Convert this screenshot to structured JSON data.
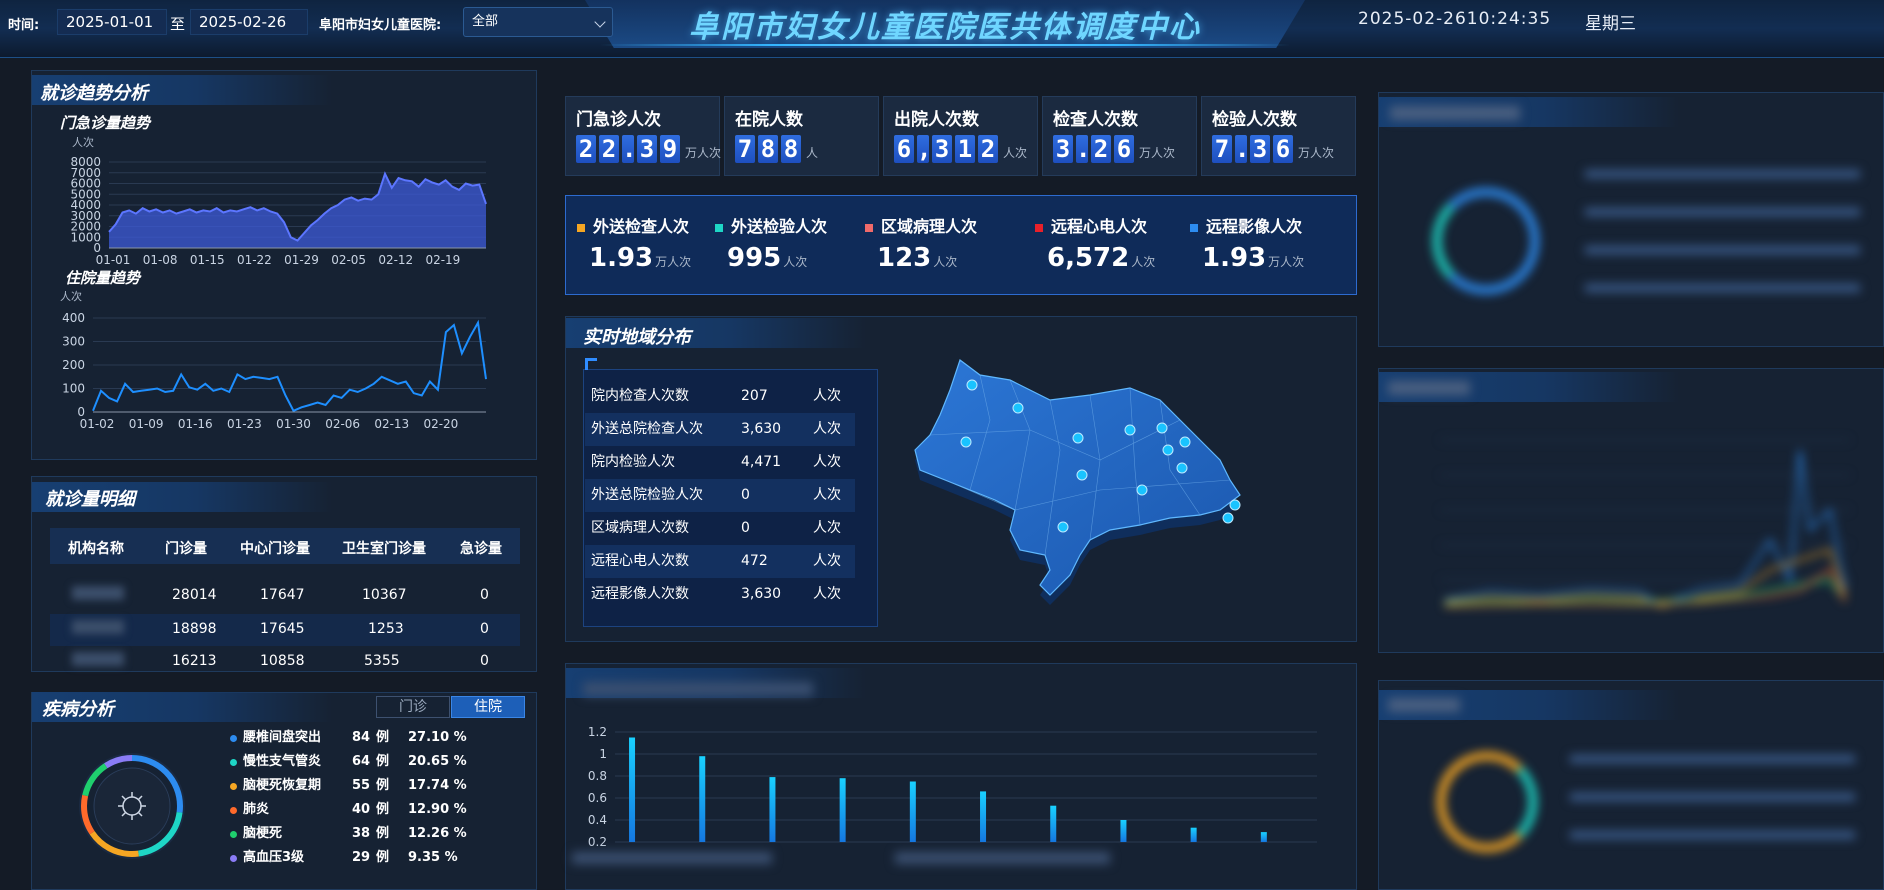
{
  "header": {
    "time_label": "时间:",
    "start_date": "2025-01-01",
    "to_label": "至",
    "end_date": "2025-02-26",
    "hospital_label": "阜阳市妇女儿童医院:",
    "hospital_select": "全部",
    "title": "阜阳市妇女儿童医院医共体调度中心",
    "datetime": "2025-02-2610:24:35",
    "weekday": "星期三",
    "accent": "#6fd6ff"
  },
  "trend_panel": {
    "title": "就诊趋势分析",
    "outpatient_title": "门急诊量趋势",
    "outpatient_unit": "人次",
    "inpatient_title": "住院量趋势",
    "inpatient_unit": "人次"
  },
  "stats": [
    {
      "label": "门急诊人次",
      "value": "22.39",
      "unit": "万人次"
    },
    {
      "label": "在院人数",
      "value": "788",
      "unit": "人"
    },
    {
      "label": "出院人次数",
      "value": "6,312",
      "unit": "人次"
    },
    {
      "label": "检查人次数",
      "value": "3.26",
      "unit": "万人次"
    },
    {
      "label": "检验人次数",
      "value": "7.36",
      "unit": "万人次"
    }
  ],
  "external": [
    {
      "label": "外送检查人次",
      "value": "1.93",
      "unit": "万人次",
      "color": "#f5a623"
    },
    {
      "label": "外送检验人次",
      "value": "995",
      "unit": "人次",
      "color": "#1ed6c6"
    },
    {
      "label": "区域病理人次",
      "value": "123",
      "unit": "人次",
      "color": "#f06a6a"
    },
    {
      "label": "远程心电人次",
      "value": "6,572",
      "unit": "人次",
      "color": "#e8202a"
    },
    {
      "label": "远程影像人次",
      "value": "1.93",
      "unit": "万人次",
      "color": "#2d8cf0"
    }
  ],
  "region": {
    "title": "实时地域分布",
    "rows": [
      {
        "name": "院内检查人次数",
        "value": "207",
        "unit": "人次"
      },
      {
        "name": "外送总院检查人次",
        "value": "3,630",
        "unit": "人次"
      },
      {
        "name": "院内检验人次",
        "value": "4,471",
        "unit": "人次"
      },
      {
        "name": "外送总院检验人次",
        "value": "0",
        "unit": "人次"
      },
      {
        "name": "区域病理人次数",
        "value": "0",
        "unit": "人次"
      },
      {
        "name": "远程心电人次数",
        "value": "472",
        "unit": "人次"
      },
      {
        "name": "远程影像人次数",
        "value": "3,630",
        "unit": "人次"
      }
    ]
  },
  "visits": {
    "title": "就诊量明细",
    "columns": [
      "机构名称",
      "门诊量",
      "中心门诊量",
      "卫生室门诊量",
      "急诊量"
    ],
    "rows": [
      {
        "name": "",
        "outpatient": "28014",
        "center": "17647",
        "clinic": "10367",
        "emergency": "0"
      },
      {
        "name": "",
        "outpatient": "18898",
        "center": "17645",
        "clinic": "1253",
        "emergency": "0"
      },
      {
        "name": "",
        "outpatient": "16213",
        "center": "10858",
        "clinic": "5355",
        "emergency": "0"
      }
    ]
  },
  "disease": {
    "title": "疾病分析",
    "tab_outpatient": "门诊",
    "tab_inpatient": "住院",
    "items": [
      {
        "name": "腰椎间盘突出",
        "count": "84",
        "unit": "例",
        "pct": "27.10 %",
        "color": "#2d8cf0"
      },
      {
        "name": "慢性支气管炎",
        "count": "64",
        "unit": "例",
        "pct": "20.65 %",
        "color": "#1ed6c6"
      },
      {
        "name": "脑梗死恢复期",
        "count": "55",
        "unit": "例",
        "pct": "17.74 %",
        "color": "#f5a623"
      },
      {
        "name": "肺炎",
        "count": "40",
        "unit": "例",
        "pct": "12.90 %",
        "color": "#ff6a2b"
      },
      {
        "name": "脑梗死",
        "count": "38",
        "unit": "例",
        "pct": "12.26 %",
        "color": "#1fcf6e"
      },
      {
        "name": "高血压3级",
        "count": "29",
        "unit": "例",
        "pct": "9.35 %",
        "color": "#8a7cf6"
      }
    ]
  },
  "chart_data": [
    {
      "type": "area",
      "title": "门急诊量趋势",
      "ylabel": "人次",
      "ylim": [
        0,
        8000
      ],
      "yticks": [
        0,
        1000,
        2000,
        3000,
        4000,
        5000,
        6000,
        7000,
        8000
      ],
      "xticks": [
        "01-01",
        "01-08",
        "01-15",
        "01-22",
        "01-29",
        "02-05",
        "02-12",
        "02-19"
      ],
      "color": "#3d5bd9",
      "values": [
        1500,
        2200,
        3300,
        3500,
        3200,
        3700,
        3400,
        3600,
        3300,
        3500,
        3200,
        3400,
        3600,
        3300,
        3500,
        3400,
        3700,
        3300,
        3500,
        3400,
        3600,
        3800,
        3500,
        3700,
        3400,
        3200,
        2400,
        1000,
        700,
        1400,
        2100,
        2600,
        3200,
        3700,
        4000,
        4500,
        4700,
        4400,
        4600,
        4500,
        5000,
        6900,
        5600,
        6500,
        6300,
        6200,
        5700,
        6400,
        6100,
        5900,
        6300,
        5700,
        5400,
        6000,
        5800,
        5900,
        4100
      ]
    },
    {
      "type": "line",
      "title": "住院量趋势",
      "ylabel": "人次",
      "ylim": [
        0,
        400
      ],
      "yticks": [
        0,
        100,
        200,
        300,
        400
      ],
      "xticks": [
        "01-02",
        "01-09",
        "01-16",
        "01-23",
        "01-30",
        "02-06",
        "02-13",
        "02-20"
      ],
      "color": "#1e8fff",
      "values": [
        5,
        90,
        60,
        45,
        120,
        85,
        90,
        95,
        100,
        85,
        90,
        160,
        105,
        95,
        120,
        90,
        100,
        85,
        160,
        140,
        150,
        145,
        140,
        150,
        70,
        5,
        20,
        30,
        40,
        30,
        70,
        60,
        95,
        85,
        100,
        120,
        150,
        135,
        120,
        130,
        80,
        70,
        130,
        95,
        340,
        370,
        250,
        320,
        380,
        140
      ]
    },
    {
      "type": "bar",
      "title": "",
      "ylim": [
        0.2,
        1.2
      ],
      "yticks": [
        0.2,
        0.4,
        0.6,
        0.8,
        1,
        1.2
      ],
      "color": "#19b8ff",
      "values": [
        1.15,
        0.98,
        0.79,
        0.78,
        0.75,
        0.66,
        0.53,
        0.4,
        0.33,
        0.29
      ]
    }
  ]
}
